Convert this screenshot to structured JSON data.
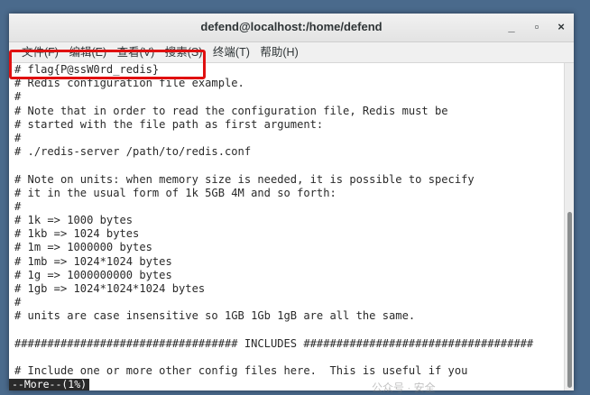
{
  "window": {
    "title": "defend@localhost:/home/defend",
    "minimize_symbol": "_",
    "maximize_symbol": "▫",
    "close_symbol": "×"
  },
  "menu": [
    {
      "label": "文件(F)"
    },
    {
      "label": "编辑(E)"
    },
    {
      "label": "查看(V)"
    },
    {
      "label": "搜索(S)"
    },
    {
      "label": "终端(T)"
    },
    {
      "label": "帮助(H)"
    }
  ],
  "terminal": {
    "lines": [
      "# flag{P@ssW0rd_redis}",
      "# Redis configuration file example.",
      "#",
      "# Note that in order to read the configuration file, Redis must be",
      "# started with the file path as first argument:",
      "#",
      "# ./redis-server /path/to/redis.conf",
      "",
      "# Note on units: when memory size is needed, it is possible to specify",
      "# it in the usual form of 1k 5GB 4M and so forth:",
      "#",
      "# 1k => 1000 bytes",
      "# 1kb => 1024 bytes",
      "# 1m => 1000000 bytes",
      "# 1mb => 1024*1024 bytes",
      "# 1g => 1000000000 bytes",
      "# 1gb => 1024*1024*1024 bytes",
      "#",
      "# units are case insensitive so 1GB 1Gb 1gB are all the same.",
      "",
      "################################## INCLUDES ###################################",
      "",
      "# Include one or more other config files here.  This is useful if you"
    ],
    "pager_status": "--More--(1%)"
  },
  "colors": {
    "highlight": "#e01010",
    "terminal_bg": "#ffffff",
    "terminal_fg": "#2a2a2a"
  },
  "watermark_text": "公众号 · 安全"
}
